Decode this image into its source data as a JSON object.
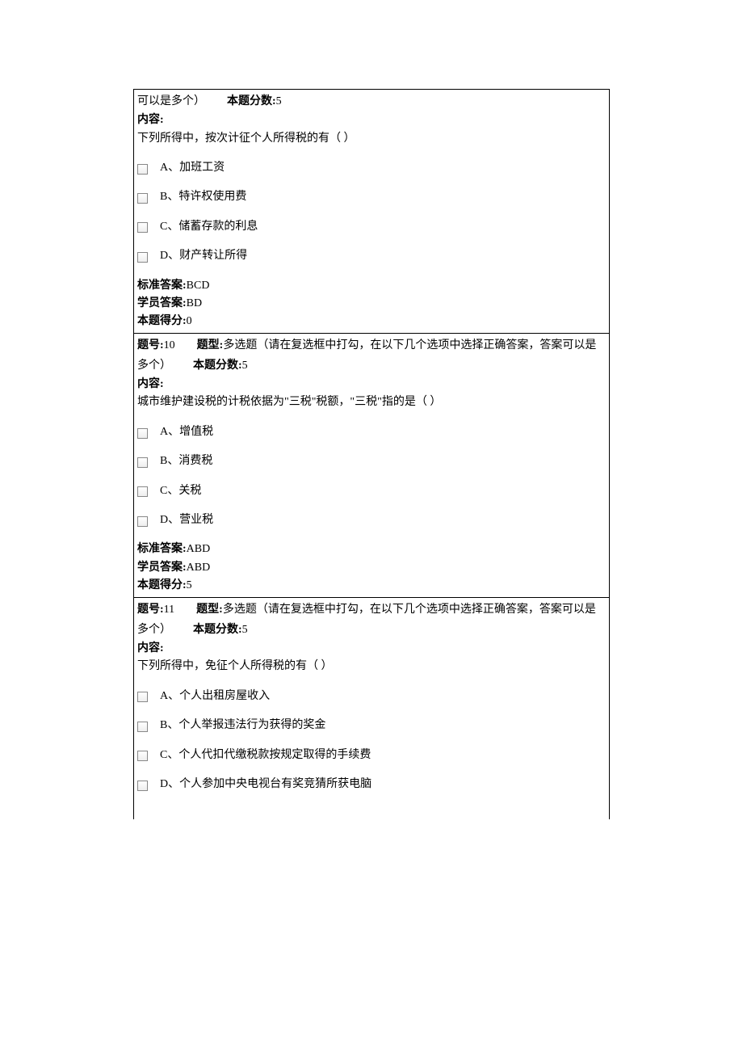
{
  "questions": [
    {
      "header_fragment": "可以是多个）",
      "score_label": "本题分数:",
      "score_value": "5",
      "content_label": "内容:",
      "content_text": "下列所得中，按次计征个人所得税的有（ ）",
      "options": [
        {
          "label": "A、加班工资"
        },
        {
          "label": "B、特许权使用费"
        },
        {
          "label": "C、储蓄存款的利息"
        },
        {
          "label": "D、财产转让所得"
        }
      ],
      "std_answer_label": "标准答案:",
      "std_answer_value": "BCD",
      "student_answer_label": "学员答案:",
      "student_answer_value": "BD",
      "got_score_label": "本题得分:",
      "got_score_value": "0"
    },
    {
      "qnum_label": "题号:",
      "qnum_value": "10",
      "type_label": "题型:",
      "type_value": "多选题（请在复选框中打勾，在以下几个选项中选择正确答案，答案可以是多个）",
      "score_label": "本题分数:",
      "score_value": "5",
      "content_label": "内容:",
      "content_text": "城市维护建设税的计税依据为\"三税\"税额，\"三税\"指的是（ ）",
      "options": [
        {
          "label": "A、增值税"
        },
        {
          "label": "B、消费税"
        },
        {
          "label": "C、关税"
        },
        {
          "label": "D、营业税"
        }
      ],
      "std_answer_label": "标准答案:",
      "std_answer_value": "ABD",
      "student_answer_label": "学员答案:",
      "student_answer_value": "ABD",
      "got_score_label": "本题得分:",
      "got_score_value": "5"
    },
    {
      "qnum_label": "题号:",
      "qnum_value": "11",
      "type_label": "题型:",
      "type_value": "多选题（请在复选框中打勾，在以下几个选项中选择正确答案，答案可以是多个）",
      "score_label": "本题分数:",
      "score_value": "5",
      "content_label": "内容:",
      "content_text": "下列所得中，免征个人所得税的有（ ）",
      "options": [
        {
          "label": "A、个人出租房屋收入"
        },
        {
          "label": "B、个人举报违法行为获得的奖金"
        },
        {
          "label": "C、个人代扣代缴税款按规定取得的手续费"
        },
        {
          "label": "D、个人参加中央电视台有奖竞猜所获电脑"
        }
      ]
    }
  ]
}
